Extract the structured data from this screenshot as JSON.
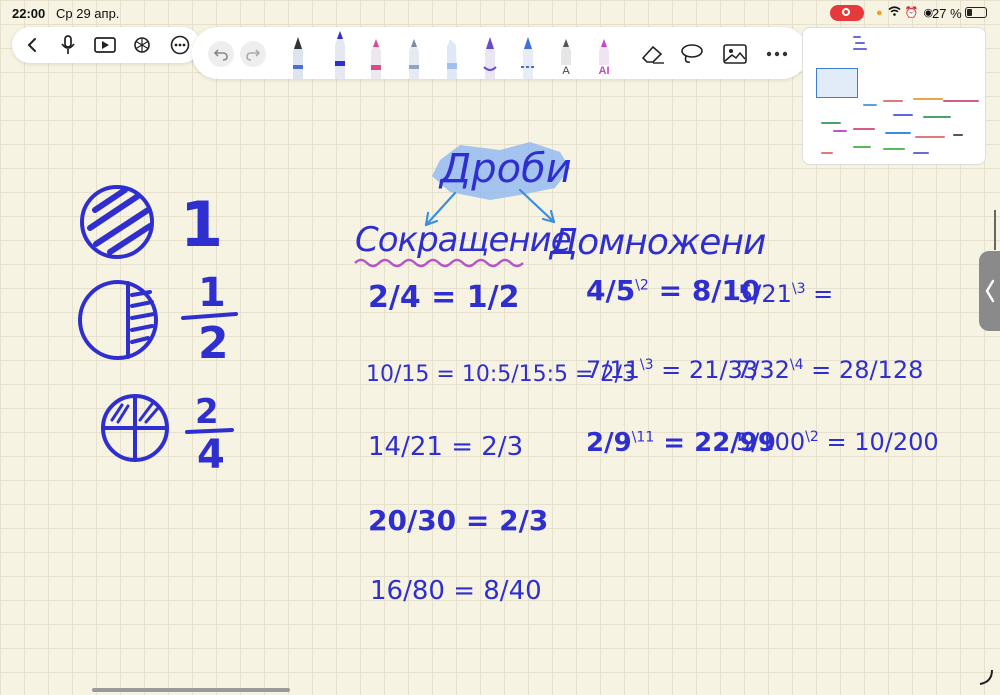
{
  "status_bar": {
    "time": "22:00",
    "date": "Ср 29 апр.",
    "battery_percent": "27 %",
    "battery_level": 0.27,
    "icons": [
      "recording-icon",
      "dot-icon",
      "wifi-icon",
      "alarm-icon",
      "location-icon",
      "battery-icon"
    ]
  },
  "nav": {
    "icons": [
      "back-icon",
      "microphone-icon",
      "play-icon",
      "ai-assistant-icon",
      "more-icon"
    ]
  },
  "toolbar": {
    "icons": [
      "undo-icon",
      "redo-icon",
      "fountain-pen-icon",
      "pen-icon",
      "marker-pen-icon",
      "pencil-icon",
      "highlighter-icon",
      "purple-pen-icon",
      "dashed-pen-icon",
      "text-pen-icon",
      "ai-pen-icon",
      "eraser-icon",
      "lasso-icon",
      "image-icon",
      "more-icon"
    ],
    "text_pen_label": "A",
    "ai_pen_label": "AI"
  },
  "notes": {
    "title": "Дроби",
    "left_branch": "Сокращение",
    "right_branch": "Домножени",
    "circles": [
      {
        "value": "1"
      },
      {
        "numerator": "1",
        "denominator": "2"
      },
      {
        "numerator": "2",
        "denominator": "4"
      }
    ],
    "reduction": [
      {
        "left": "2/4",
        "right": "1/2"
      },
      {
        "left": "10/15",
        "middle": "10:5/15:5",
        "right": "2/3"
      },
      {
        "left": "14/21",
        "right": "2/3"
      },
      {
        "left": "20/30",
        "right": "2/3"
      },
      {
        "left": "16/80",
        "right": "8/40"
      }
    ],
    "multiplication": [
      {
        "left": "4/5",
        "factor": "2",
        "right": "8/10"
      },
      {
        "left": "5/21",
        "factor": "3",
        "right": ""
      },
      {
        "left": "7/11",
        "factor": "3",
        "right": "21/33"
      },
      {
        "left": "7/32",
        "factor": "4",
        "right": "28/128"
      },
      {
        "left": "2/9",
        "factor": "11",
        "right": "22/99"
      },
      {
        "left": "5/100",
        "factor": "2",
        "right": "10/200"
      }
    ]
  },
  "colors": {
    "ink": "#2f2fd0",
    "title_highlight": "#8fb7f0",
    "squiggle": "#b455c9",
    "arrow": "#3a8de0",
    "recording": "#e5393c"
  }
}
